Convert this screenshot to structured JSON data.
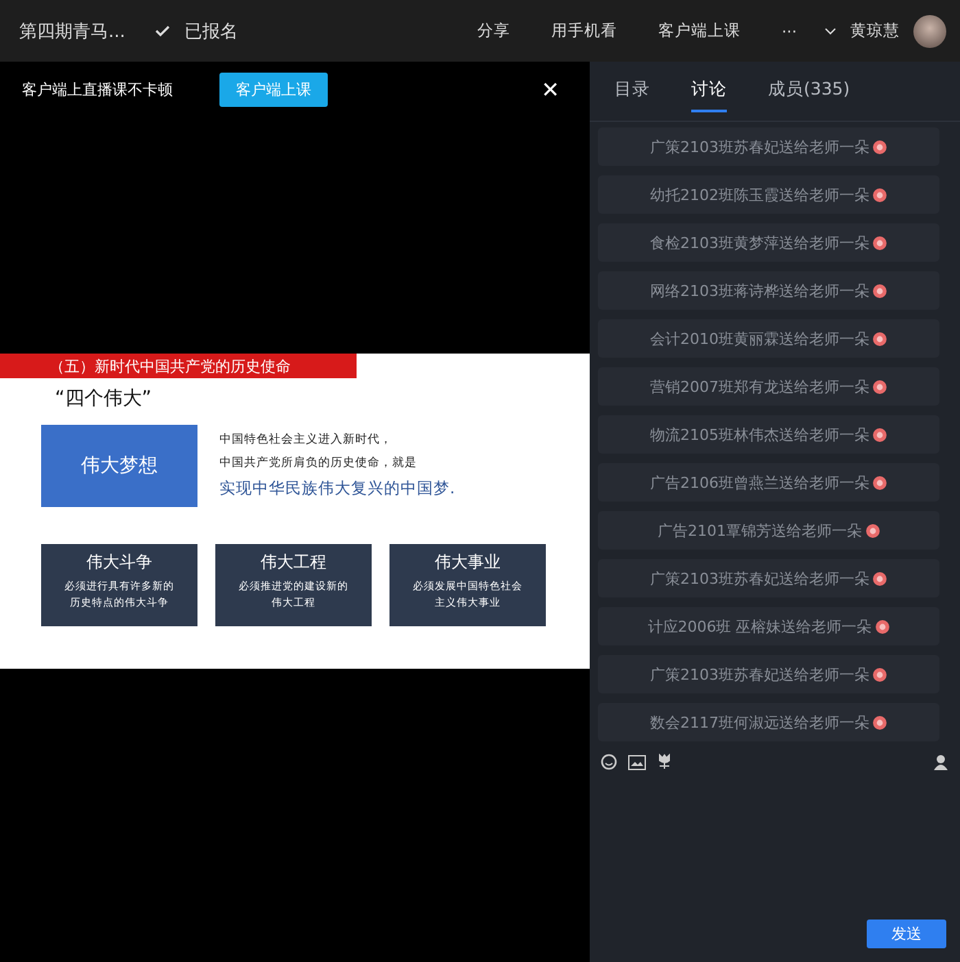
{
  "header": {
    "course_title": "第四期青马...",
    "enroll_status": "已报名",
    "actions": [
      "分享",
      "用手机看",
      "客户端上课",
      "···"
    ],
    "user_name": "黄琼慧"
  },
  "banner": {
    "text": "客户端上直播课不卡顿",
    "button": "客户端上课",
    "close": "✕"
  },
  "slide": {
    "heading": "（五）新时代中国共产党的历史使命",
    "subtitle": "“四个伟大”",
    "main_box": "伟大梦想",
    "lines": [
      "中国特色社会主义进入新时代，",
      "中国共产党所肩负的历史使命，就是"
    ],
    "highlight": "实现中华民族伟大复兴的中国梦.",
    "cards": [
      {
        "title": "伟大斗争",
        "body": "必须进行具有许多新的历史特点的伟大斗争"
      },
      {
        "title": "伟大工程",
        "body": "必须推进党的建设新的伟大工程"
      },
      {
        "title": "伟大事业",
        "body": "必须发展中国特色社会主义伟大事业"
      }
    ]
  },
  "tabs": [
    {
      "label": "目录",
      "selected": false
    },
    {
      "label": "讨论",
      "selected": true
    },
    {
      "label": "成员(335)",
      "selected": false
    }
  ],
  "messages": [
    "广策2103班苏春妃送给老师一朵",
    "幼托2102班陈玉霞送给老师一朵",
    "食检2103班黄梦萍送给老师一朵",
    "网络2103班蒋诗桦送给老师一朵",
    "会计2010班黄丽霖送给老师一朵",
    "营销2007班郑有龙送给老师一朵",
    "物流2105班林伟杰送给老师一朵",
    "广告2106班曾燕兰送给老师一朵",
    "广告2101覃锦芳送给老师一朵",
    "广策2103班苏春妃送给老师一朵",
    "计应2006班 巫榕妹送给老师一朵",
    "广策2103班苏春妃送给老师一朵",
    "数会2117班何淑远送给老师一朵"
  ],
  "send_button": "发送"
}
